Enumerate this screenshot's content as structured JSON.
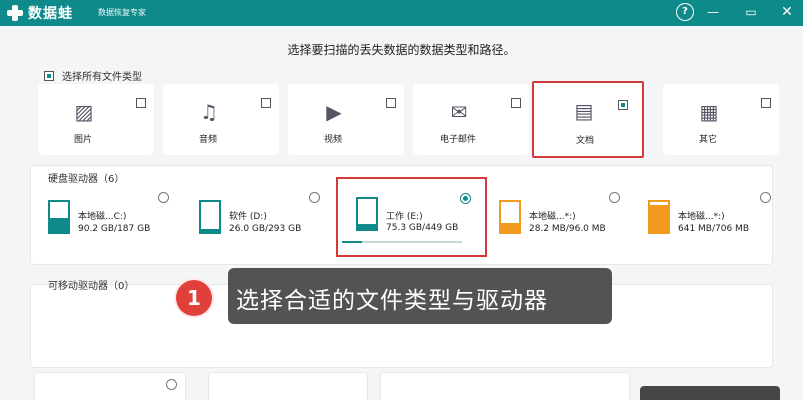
{
  "app": {
    "logo_text": "数据蛙",
    "subtitle": "数据恢复专家",
    "help_label": "?",
    "minimize_label": "—",
    "maximize_label": "▭",
    "close_label": "✕"
  },
  "heading": "选择要扫描的丢失数据的数据类型和路径。",
  "select_all_label": "选择所有文件类型",
  "file_types": [
    {
      "label": "图片",
      "icon": "image-icon",
      "checked": false
    },
    {
      "label": "音频",
      "icon": "music-icon",
      "checked": false
    },
    {
      "label": "视频",
      "icon": "video-icon",
      "checked": false
    },
    {
      "label": "电子邮件",
      "icon": "mail-icon",
      "checked": false
    },
    {
      "label": "文档",
      "icon": "document-icon",
      "checked": true
    },
    {
      "label": "其它",
      "icon": "grid-icon",
      "checked": false
    }
  ],
  "hard_drives": {
    "title": "硬盘驱动器（6）",
    "items": [
      {
        "name": "本地磁...C:)",
        "size": "90.2 GB/187 GB",
        "color": "#0f8a8a",
        "fill_fraction": 0.48,
        "selected": false
      },
      {
        "name": "软件 (D:)",
        "size": "26.0 GB/293 GB",
        "color": "#0f8a8a",
        "fill_fraction": 0.09,
        "selected": false
      },
      {
        "name": "工作 (E:)",
        "size": "75.3 GB/449 GB",
        "color": "#0f8a8a",
        "fill_fraction": 0.17,
        "selected": true
      },
      {
        "name": "本地磁...*:)",
        "size": "28.2 MB/96.0 MB",
        "color": "#f29a1e",
        "fill_fraction": 0.29,
        "selected": false
      },
      {
        "name": "本地磁...*:)",
        "size": "641 MB/706 MB",
        "color": "#f29a1e",
        "fill_fraction": 0.91,
        "selected": false
      }
    ]
  },
  "removable_drives": {
    "title": "可移动驱动器（0）"
  },
  "callout": {
    "number": "1",
    "text": "选择合适的文件类型与驱动器"
  },
  "colors": {
    "accent": "#0f8a8a",
    "highlight": "#d43a3a"
  }
}
